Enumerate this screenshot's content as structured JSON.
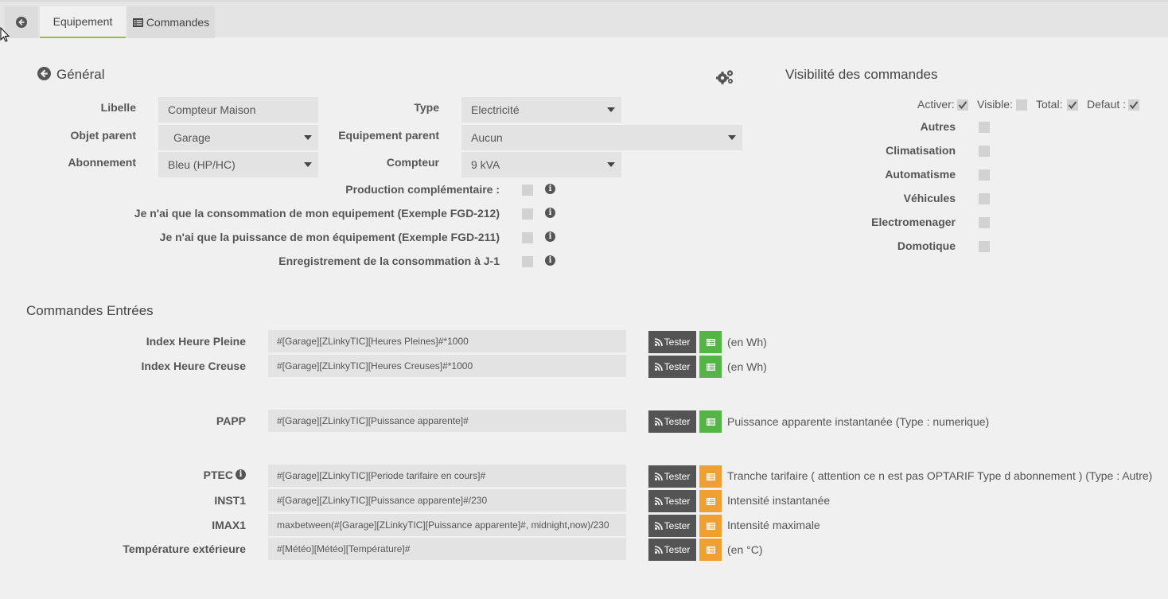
{
  "tabs": {
    "back_icon": "arrow-circle-left-icon",
    "equipement": "Equipement",
    "commandes": "Commandes"
  },
  "general": {
    "title": "Général",
    "libelle_label": "Libelle",
    "libelle_value": "Compteur Maison",
    "objet_parent_label": "Objet parent",
    "objet_parent_value": "Garage",
    "abonnement_label": "Abonnement",
    "abonnement_value": "Bleu (HP/HC)",
    "type_label": "Type",
    "type_value": "Electricité",
    "equipement_parent_label": "Equipement parent",
    "equipement_parent_value": "Aucun",
    "compteur_label": "Compteur",
    "compteur_value": "9 kVA",
    "options": [
      {
        "label": "Production complémentaire :",
        "checked": false
      },
      {
        "label": "Je n'ai que la consommation de mon equipement (Exemple FGD-212)",
        "checked": false
      },
      {
        "label": "Je n'ai que la puissance de mon équipement (Exemple FGD-211)",
        "checked": false
      },
      {
        "label": "Enregistrement de la consommation à J-1",
        "checked": false
      }
    ]
  },
  "visibility": {
    "title": "Visibilité des commandes",
    "activer": "Activer:",
    "visible": "Visible:",
    "total": "Total:",
    "defaut": "Defaut :",
    "categories": [
      "Autres",
      "Climatisation",
      "Automatisme",
      "Véhicules",
      "Electromenager",
      "Domotique"
    ]
  },
  "commands": {
    "title": "Commandes Entrées",
    "tester_label": "Tester",
    "rows": [
      {
        "label": "Index Heure Pleine",
        "value": "#[Garage][ZLinkyTIC][Heures Pleines]#*1000",
        "desc": "(en Wh)",
        "color": "#53b543"
      },
      {
        "label": "Index Heure Creuse",
        "value": "#[Garage][ZLinkyTIC][Heures Creuses]#*1000",
        "desc": "(en Wh)",
        "color": "#53b543"
      },
      {
        "label": "PAPP",
        "value": "#[Garage][ZLinkyTIC][Puissance apparente]#",
        "desc": "Puissance apparente instantanée (Type : numerique)",
        "color": "#53b543"
      },
      {
        "label": "PTEC",
        "value": "#[Garage][ZLinkyTIC][Periode tarifaire en cours]#",
        "desc": "Tranche tarifaire ( attention ce n est pas OPTARIF Type d abonnement ) (Type : Autre)",
        "color": "#f0a030"
      },
      {
        "label": "INST1",
        "value": "#[Garage][ZLinkyTIC][Puissance apparente]#/230",
        "desc": "Intensité instantanée",
        "color": "#f0a030"
      },
      {
        "label": "IMAX1",
        "value": "maxbetween(#[Garage][ZLinkyTIC][Puissance apparente]#, midnight,now)/230",
        "desc": "Intensité maximale",
        "color": "#f0a030"
      },
      {
        "label": "Température extérieure",
        "value": "#[Météo][Météo][Température]#",
        "desc": "(en °C)",
        "color": "#f0a030"
      }
    ]
  }
}
